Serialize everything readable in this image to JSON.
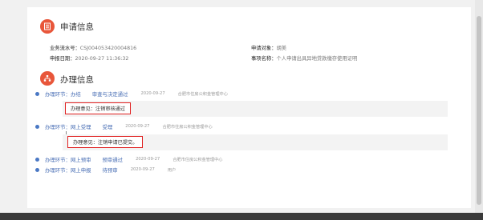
{
  "apply_info": {
    "title": "申请信息",
    "serial_label": "业务流水号：",
    "serial_value": "CSJ004053420004816",
    "date_label": "申报日期：",
    "date_value": "2020-09-27 11:36:32",
    "applicant_label": "申请对象：",
    "applicant_value": "胡美",
    "matter_label": "事项名称：",
    "matter_value": "个人申请出具异地贷款缴存使用证明"
  },
  "process_info": {
    "title": "办理信息",
    "steps": [
      {
        "segment": "办理环节：办结",
        "status": "审查与决定通过",
        "date": "2020-09-27",
        "org": "合肥市住房公积金管理中心"
      },
      {
        "segment": "办理环节：网上受理",
        "status": "受理",
        "date": "2020-09-27",
        "org": "合肥市住房公积金管理中心"
      },
      {
        "segment": "办理环节：网上预审",
        "status": "预审通过",
        "date": "2020-09-27",
        "org": "合肥市住房公积金管理中心"
      },
      {
        "segment": "办理环节：网上申报",
        "status": "待预审",
        "date": "2020-09-27",
        "org": "用户"
      }
    ],
    "opinions": [
      "办理意见：注销审核通过",
      "办理意见：注销申请已提交。"
    ]
  },
  "colors": {
    "accent_icon": "#e8563a",
    "link_blue": "#4a6fb5",
    "highlight_border": "#e02020"
  }
}
